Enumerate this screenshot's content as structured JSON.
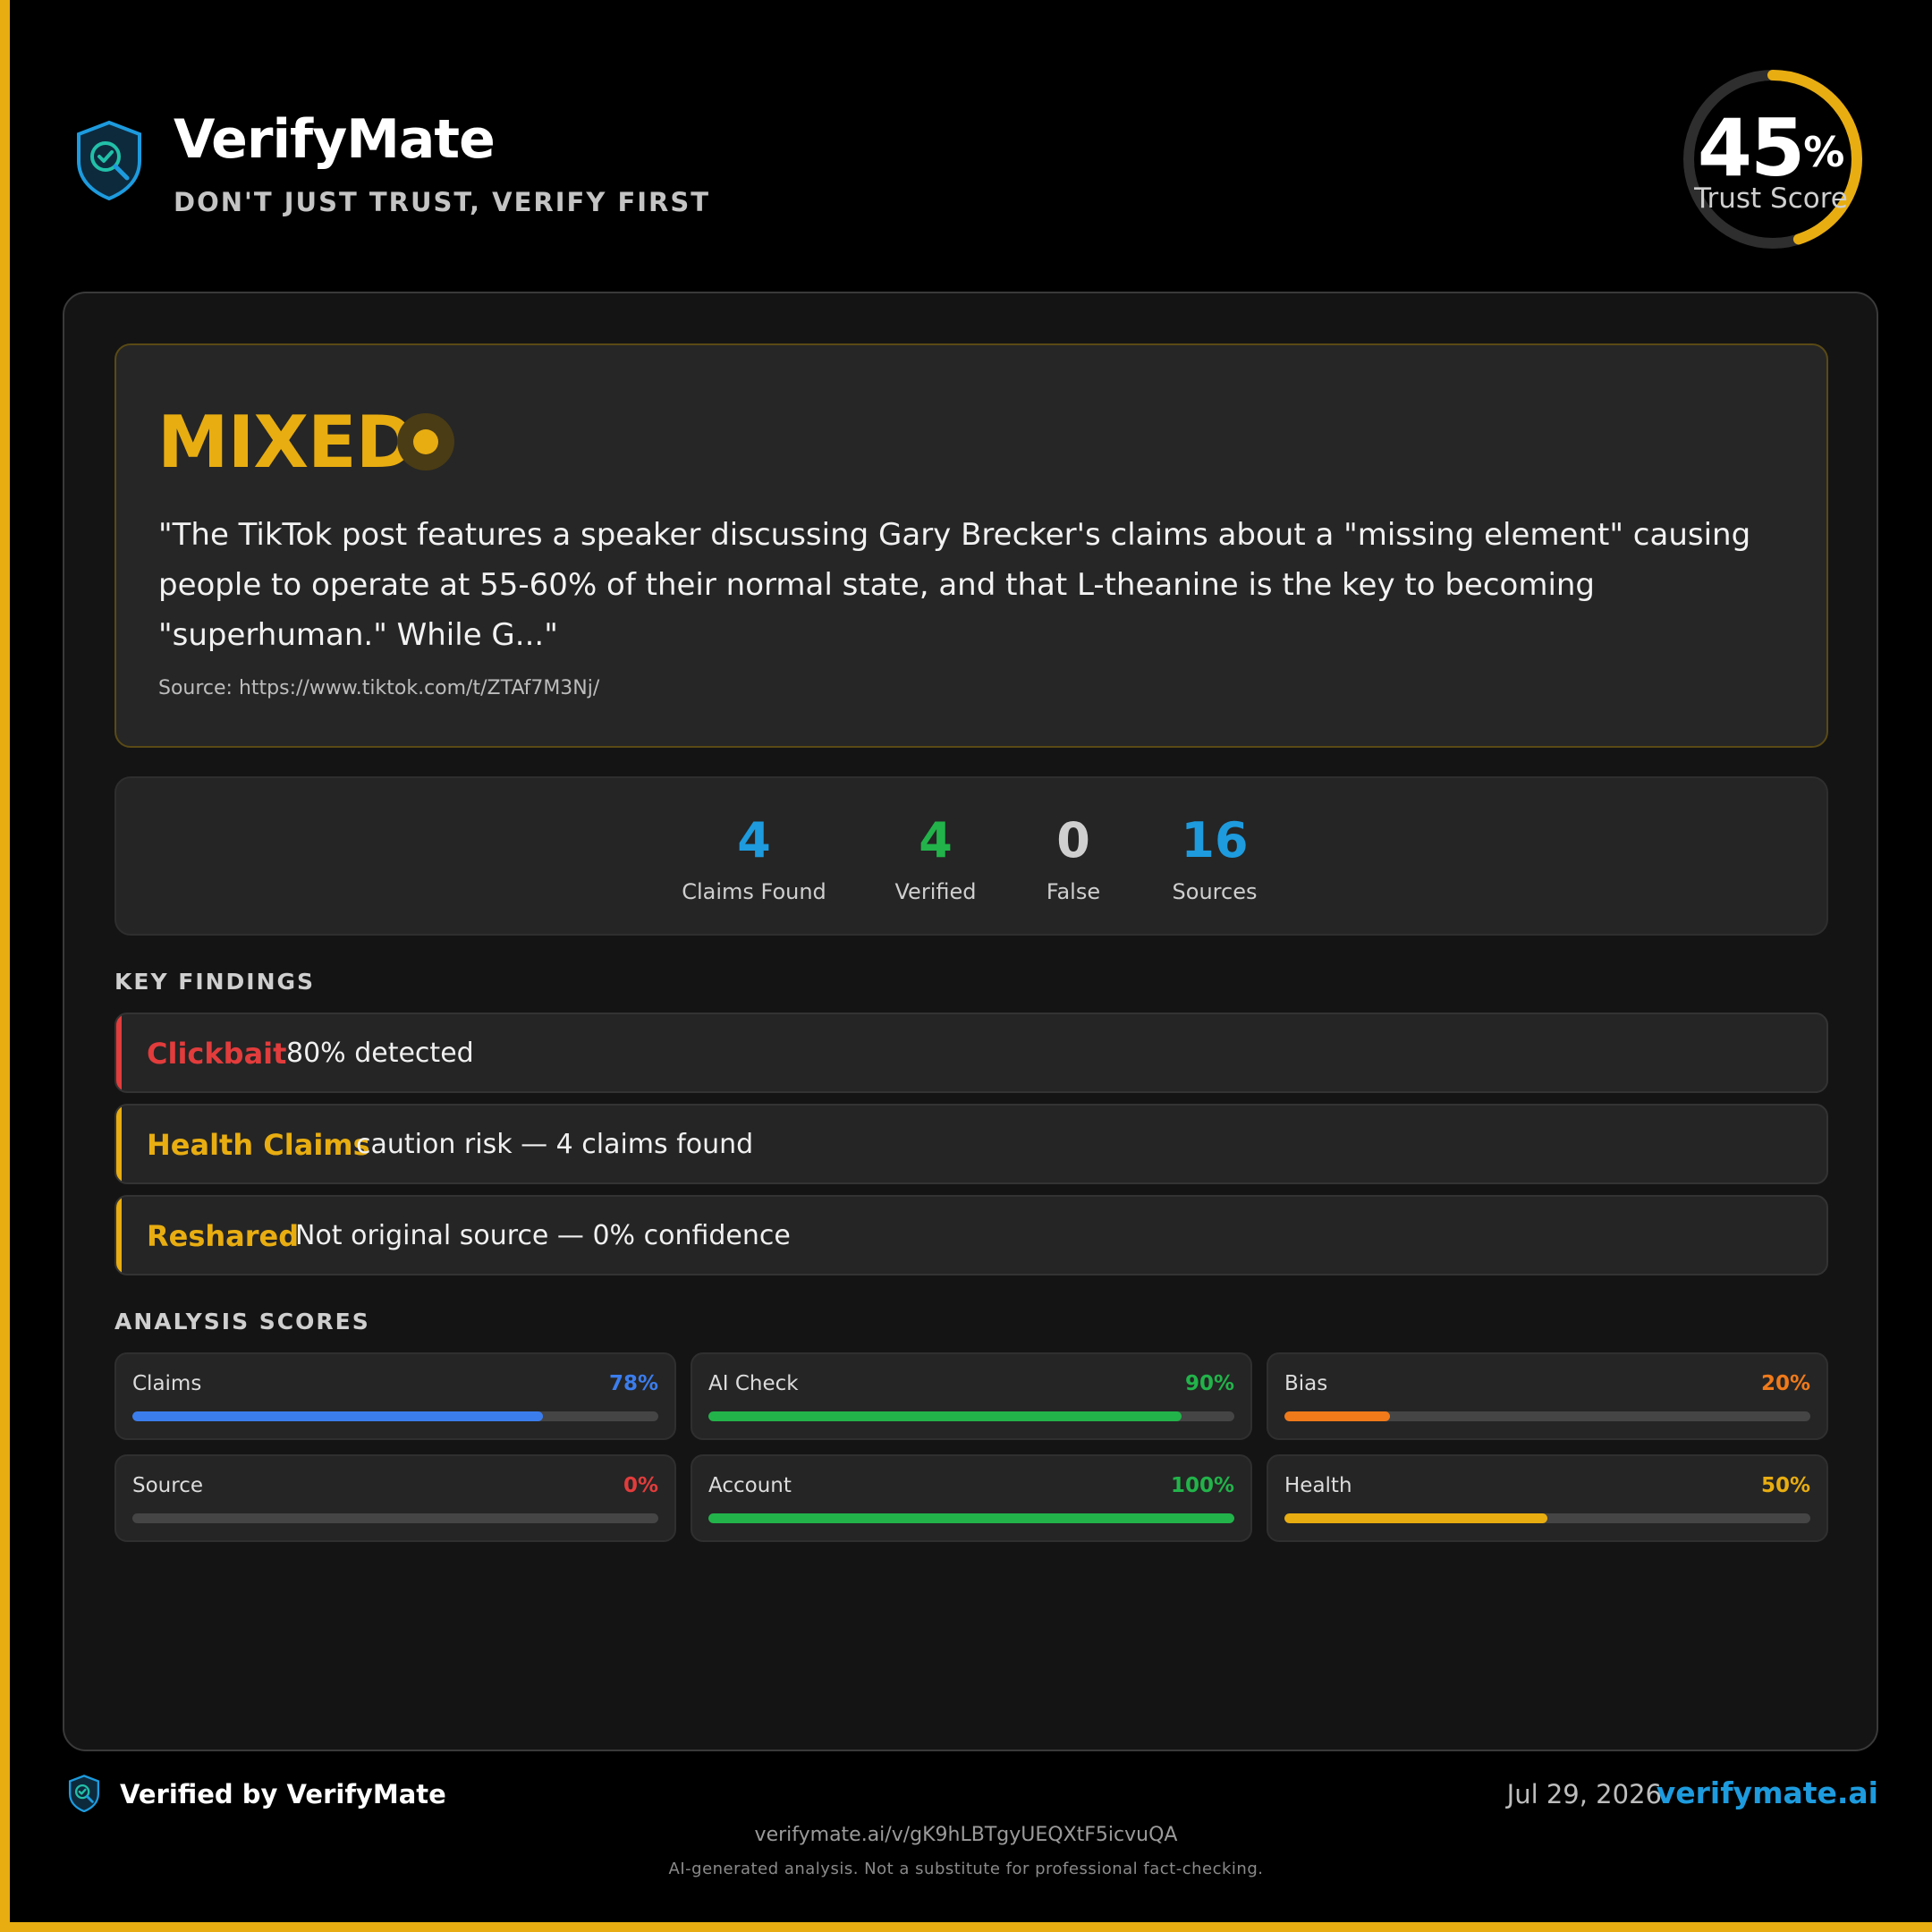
{
  "brand": {
    "name": "VerifyMate",
    "tagline": "DON'T JUST TRUST, VERIFY FIRST"
  },
  "trust_score": {
    "value": "45",
    "percent_sign": "%",
    "label": "Trust Score",
    "fraction": 0.45,
    "color": "#e8ad11"
  },
  "verdict": {
    "title": "MIXED",
    "color": "#e8ad11",
    "quote": "\"The TikTok post features a speaker discussing Gary Brecker's claims about a \"missing element\" causing people to operate at 55-60% of their normal state, and that L-theanine is the key to becoming \"superhuman.\" While G...\"",
    "source": "Source: https://www.tiktok.com/t/ZTAf7M3Nj/"
  },
  "stats": [
    {
      "value": "4",
      "label": "Claims Found",
      "color": "#1d9bde"
    },
    {
      "value": "4",
      "label": "Verified",
      "color": "#22b34a"
    },
    {
      "value": "0",
      "label": "False",
      "color": "#cfcfcf"
    },
    {
      "value": "16",
      "label": "Sources",
      "color": "#1d9bde"
    }
  ],
  "key_findings": {
    "heading": "KEY FINDINGS",
    "items": [
      {
        "title": "Clickbait",
        "text": "80% detected",
        "color": "#e23c3c"
      },
      {
        "title": "Health Claims",
        "text": "caution risk — 4 claims found",
        "color": "#e8ad11"
      },
      {
        "title": "Reshared",
        "text": "Not original source — 0% confidence",
        "color": "#e8ad11"
      }
    ]
  },
  "analysis_scores": {
    "heading": "ANALYSIS SCORES",
    "items": [
      {
        "label": "Claims",
        "value": "78%",
        "fraction": 0.78,
        "color": "#3b7ded"
      },
      {
        "label": "AI Check",
        "value": "90%",
        "fraction": 0.9,
        "color": "#22b34a"
      },
      {
        "label": "Bias",
        "value": "20%",
        "fraction": 0.2,
        "color": "#f07a1a"
      },
      {
        "label": "Source",
        "value": "0%",
        "fraction": 0.0,
        "color": "#e23c3c"
      },
      {
        "label": "Account",
        "value": "100%",
        "fraction": 1.0,
        "color": "#22b34a"
      },
      {
        "label": "Health",
        "value": "50%",
        "fraction": 0.5,
        "color": "#e8ad11"
      }
    ]
  },
  "footer": {
    "verified_by": "Verified by VerifyMate",
    "date": "Jul 29, 2026",
    "site": "verifymate.ai",
    "share_url": "verifymate.ai/v/gK9hLBTgyUEQXtF5icvuQA",
    "disclaimer": "AI-generated analysis. Not a substitute for professional fact-checking."
  },
  "icons": {
    "brand": "shield-check-search-icon"
  }
}
